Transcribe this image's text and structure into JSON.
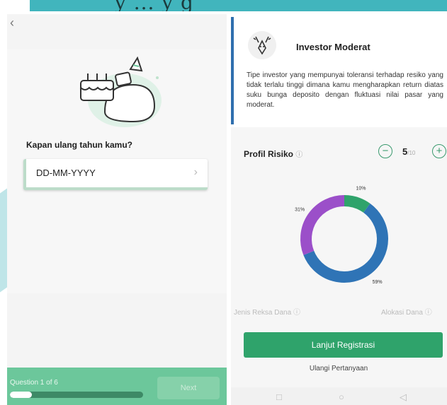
{
  "banner": {
    "text": "y ... y g"
  },
  "left": {
    "question": "Kapan ulang tahun kamu?",
    "date_placeholder": "DD-MM-YYYY",
    "progress_text": "Question 1 of 6",
    "progress_fraction": 0.167,
    "next_label": "Next"
  },
  "profile": {
    "title": "Investor Moderat",
    "description": "Tipe investor yang mempunyai toleransi terhadap resiko yang tidak terlalu tinggi dimana kamu mengharapkan return diatas suku bunga deposito dengan fluktuasi nilai pasar yang moderat."
  },
  "risk": {
    "label": "Profil Risiko",
    "value": "5",
    "max": "/10"
  },
  "chart_data": {
    "type": "pie",
    "donut": true,
    "slices": [
      {
        "label": "10%",
        "value": 10,
        "color": "#2fa36b"
      },
      {
        "label": "59%",
        "value": 59,
        "color": "#2f74b6"
      },
      {
        "label": "31%",
        "value": 31,
        "color": "#9b4fc9"
      }
    ]
  },
  "labels": {
    "fund_type": "Jenis Reksa Dana",
    "allocation": "Alokasi Dana"
  },
  "actions": {
    "continue": "Lanjut Registrasi",
    "retake": "Ulangi Pertanyaan"
  },
  "colors": {
    "accent": "#2fa36b",
    "teal": "#41b5bd",
    "blue": "#2f74b6",
    "purple": "#9b4fc9"
  }
}
